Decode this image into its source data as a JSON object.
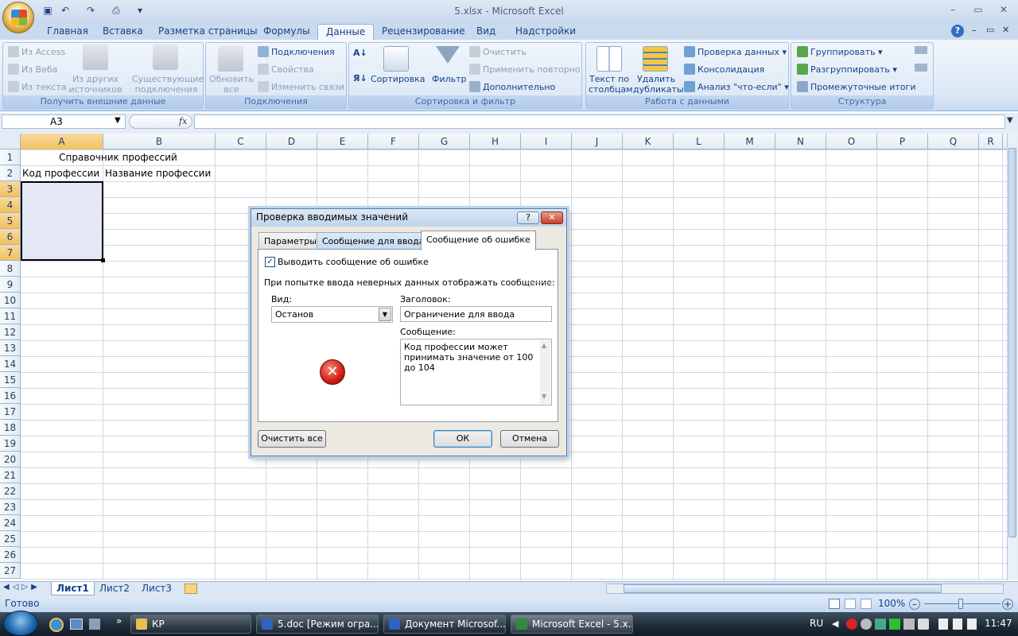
{
  "window": {
    "title": "5.xlsx - Microsoft Excel"
  },
  "ribbon": {
    "tabs": [
      "Главная",
      "Вставка",
      "Разметка страницы",
      "Формулы",
      "Данные",
      "Рецензирование",
      "Вид",
      "Надстройки"
    ],
    "active_tab": "Данные",
    "groups": {
      "external": {
        "label": "Получить внешние данные",
        "from_access": "Из Access",
        "from_web": "Из Веба",
        "from_text": "Из текста",
        "from_other": "Из других источников",
        "existing": "Существующие подключения"
      },
      "connections": {
        "label": "Подключения",
        "refresh_all": "Обновить все",
        "connections": "Подключения",
        "properties": "Свойства",
        "edit_links": "Изменить связи"
      },
      "sort_filter": {
        "label": "Сортировка и фильтр",
        "sort": "Сортировка",
        "filter": "Фильтр",
        "clear": "Очистить",
        "reapply": "Применить повторно",
        "advanced": "Дополнительно"
      },
      "data_tools": {
        "label": "Работа с данными",
        "text_to_columns": "Текст по столбцам",
        "remove_duplicates": "Удалить дубликаты",
        "data_validation": "Проверка данных",
        "consolidate": "Консолидация",
        "what_if": "Анализ \"что-если\""
      },
      "outline": {
        "label": "Структура",
        "group": "Группировать",
        "ungroup": "Разгруппировать",
        "subtotal": "Промежуточные итоги"
      }
    }
  },
  "formula_bar": {
    "name_box": "A3",
    "fx": "fx",
    "formula": ""
  },
  "grid": {
    "columns": [
      "A",
      "B",
      "C",
      "D",
      "E",
      "F",
      "G",
      "H",
      "I",
      "J",
      "K",
      "L",
      "M",
      "N",
      "O",
      "P",
      "Q",
      "R"
    ],
    "rows": [
      "1",
      "2",
      "3",
      "4",
      "5",
      "6",
      "7",
      "8",
      "9",
      "10",
      "11",
      "12",
      "13",
      "14",
      "15",
      "16",
      "17",
      "18",
      "19",
      "20",
      "21",
      "22",
      "23",
      "24",
      "25",
      "26",
      "27"
    ],
    "cells": {
      "A1": "Справочник профессий",
      "A2": "Код профессии",
      "B2": "Название профессии"
    }
  },
  "sheets": [
    "Лист1",
    "Лист2",
    "Лист3"
  ],
  "status": {
    "ready": "Готово",
    "zoom": "100%"
  },
  "dialog": {
    "title": "Проверка вводимых значений",
    "help": "?",
    "tabs": [
      "Параметры",
      "Сообщение для ввода",
      "Сообщение об ошибке"
    ],
    "show_error_label": "Выводить сообщение об ошибке",
    "show_error_checked": true,
    "section_label": "При попытке ввода неверных данных отображать сообщение:",
    "style_label": "Вид:",
    "style_value": "Останов",
    "title_label": "Заголовок:",
    "title_value": "Ограничение для ввода",
    "message_label": "Сообщение:",
    "message_value": "Код профессии может принимать значение от 100 до 104",
    "clear_all": "Очистить все",
    "ok": "ОК",
    "cancel": "Отмена"
  },
  "taskbar": {
    "items": [
      "КР",
      "5.doc [Режим огра...",
      "Документ Microsof...",
      "Microsoft Excel - 5.x..."
    ],
    "lang": "RU",
    "clock": "11:47"
  }
}
